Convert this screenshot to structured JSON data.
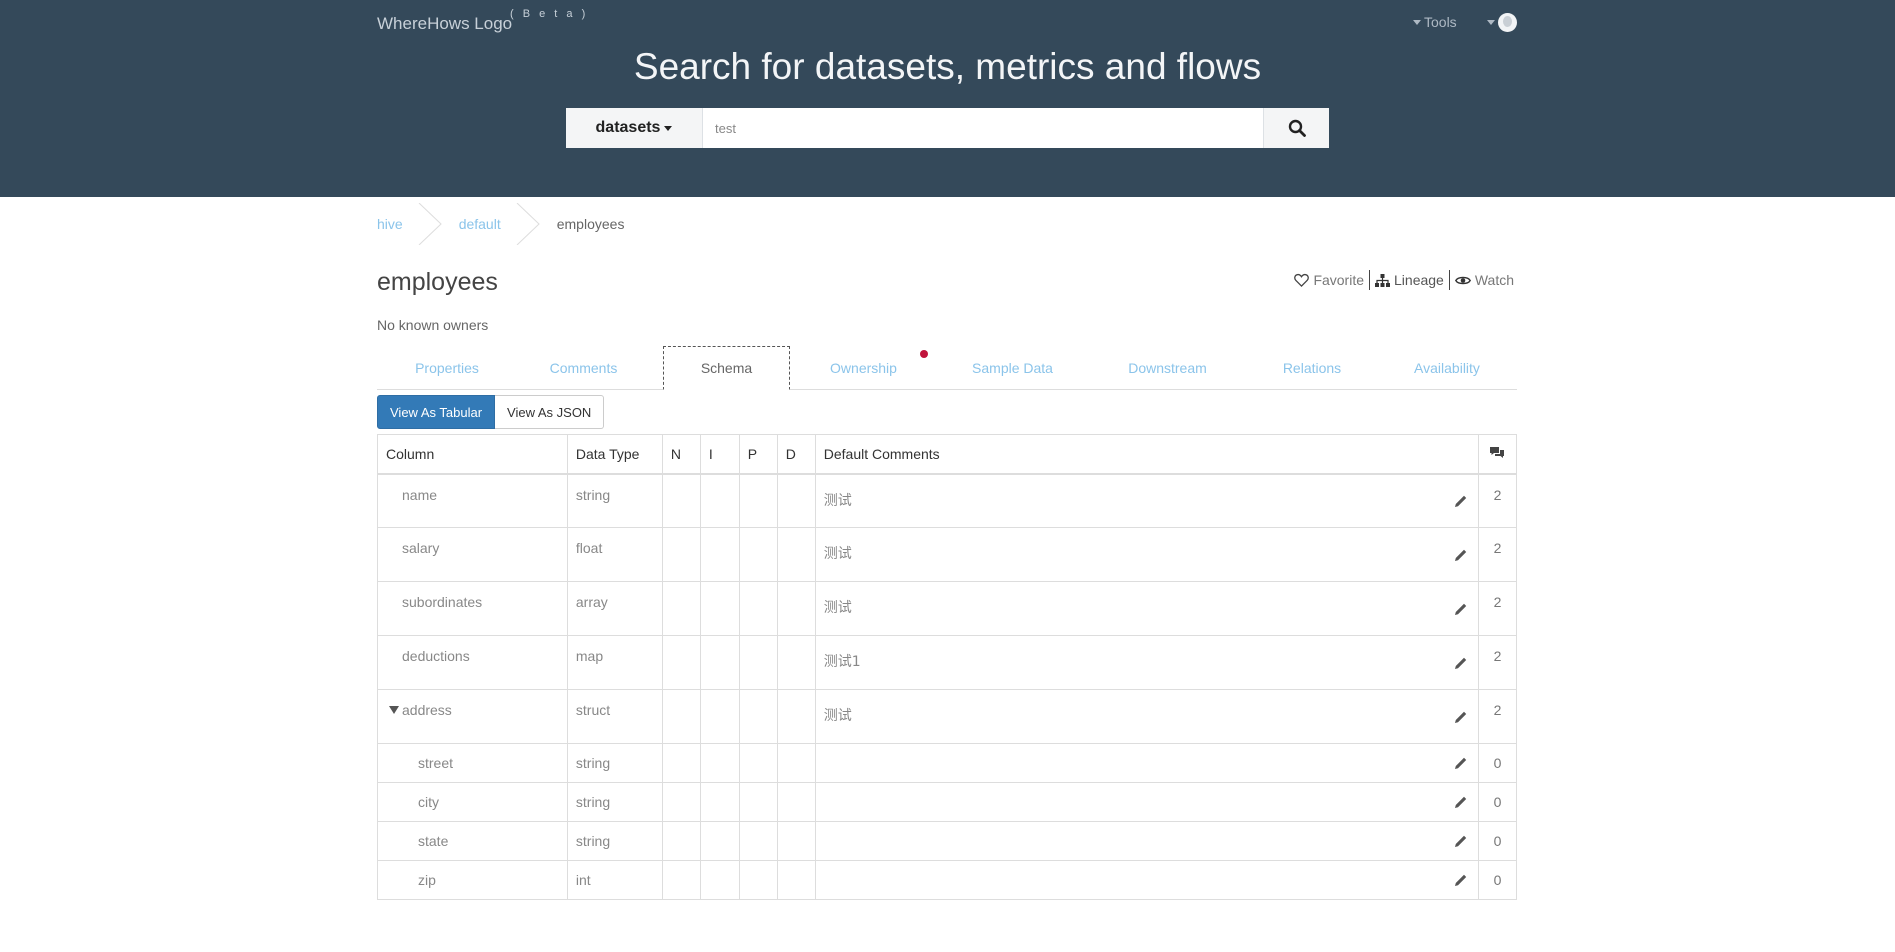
{
  "header": {
    "logo_text": "WhereHows Logo",
    "beta_text": "( B e t a )",
    "tools_label": "Tools",
    "hero_title": "Search for datasets, metrics and flows",
    "search": {
      "category": "datasets",
      "value": "test"
    }
  },
  "breadcrumb": [
    "hive",
    "default",
    "employees"
  ],
  "dataset": {
    "title": "employees",
    "owners": "No known owners"
  },
  "actions": {
    "favorite": "Favorite",
    "lineage": "Lineage",
    "watch": "Watch"
  },
  "tabs": [
    {
      "label": "Properties"
    },
    {
      "label": "Comments"
    },
    {
      "label": "Schema"
    },
    {
      "label": "Ownership"
    },
    {
      "label": "Sample Data"
    },
    {
      "label": "Downstream"
    },
    {
      "label": "Relations"
    },
    {
      "label": "Availability"
    }
  ],
  "view_toggle": {
    "tabular": "View As Tabular",
    "json": "View As JSON"
  },
  "schema": {
    "headers": {
      "column": "Column",
      "data_type": "Data Type",
      "n": "N",
      "i": "I",
      "p": "P",
      "d": "D",
      "default_comments": "Default Comments"
    },
    "rows": [
      {
        "column": "name",
        "type": "string",
        "comment": "测试",
        "count": "2"
      },
      {
        "column": "salary",
        "type": "float",
        "comment": "测试",
        "count": "2"
      },
      {
        "column": "subordinates",
        "type": "array",
        "comment": "测试",
        "count": "2"
      },
      {
        "column": "deductions",
        "type": "map",
        "comment": "测试1",
        "count": "2"
      },
      {
        "column": "address",
        "type": "struct",
        "comment": "测试",
        "count": "2"
      },
      {
        "column": "street",
        "type": "string",
        "comment": "",
        "count": "0"
      },
      {
        "column": "city",
        "type": "string",
        "comment": "",
        "count": "0"
      },
      {
        "column": "state",
        "type": "string",
        "comment": "",
        "count": "0"
      },
      {
        "column": "zip",
        "type": "int",
        "comment": "",
        "count": "0"
      }
    ]
  },
  "colors": {
    "header_bg": "#34495a",
    "link": "#8bc4ea",
    "primary": "#337ab7",
    "notify": "#c0143c"
  }
}
